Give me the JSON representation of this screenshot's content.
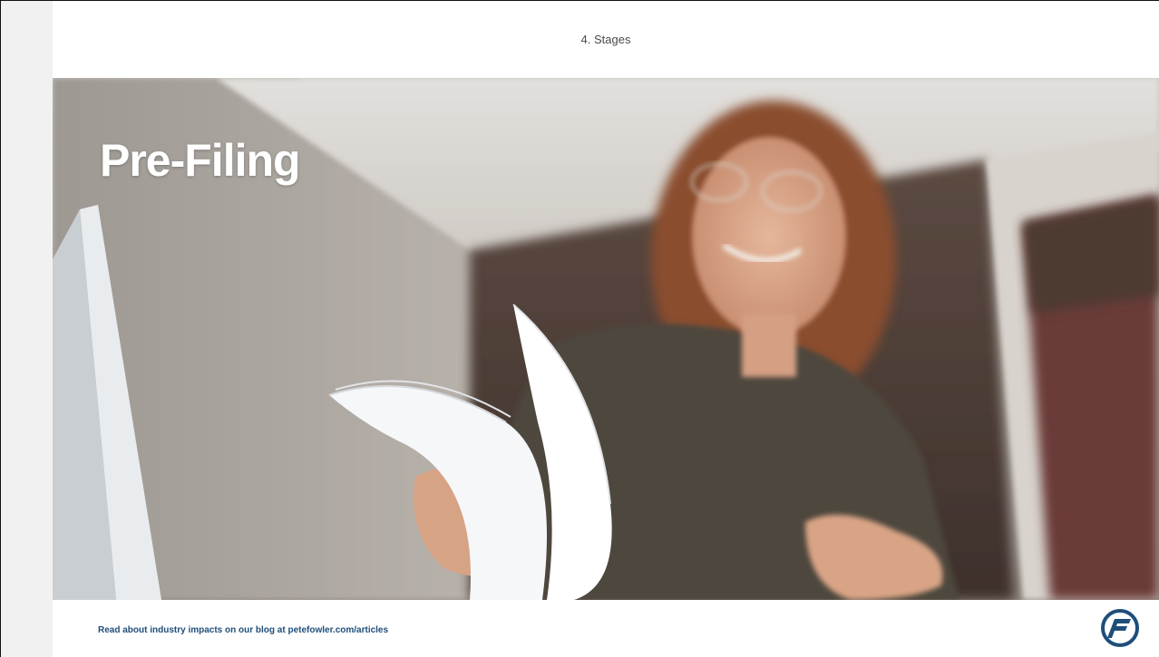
{
  "slide": {
    "header": "4. Stages",
    "title": "Pre-Filing",
    "footer_text": "Read about industry impacts on our blog at petefowler.com/articles"
  },
  "hero_image": {
    "description_icon": "woman-with-papers-photo"
  },
  "logo": {
    "icon": "pete-fowler-logo-icon"
  },
  "colors": {
    "footer_link": "#1f4e79",
    "logo": "#1f4e79",
    "title": "#ffffff",
    "side_strip": "#f1f1f1"
  }
}
